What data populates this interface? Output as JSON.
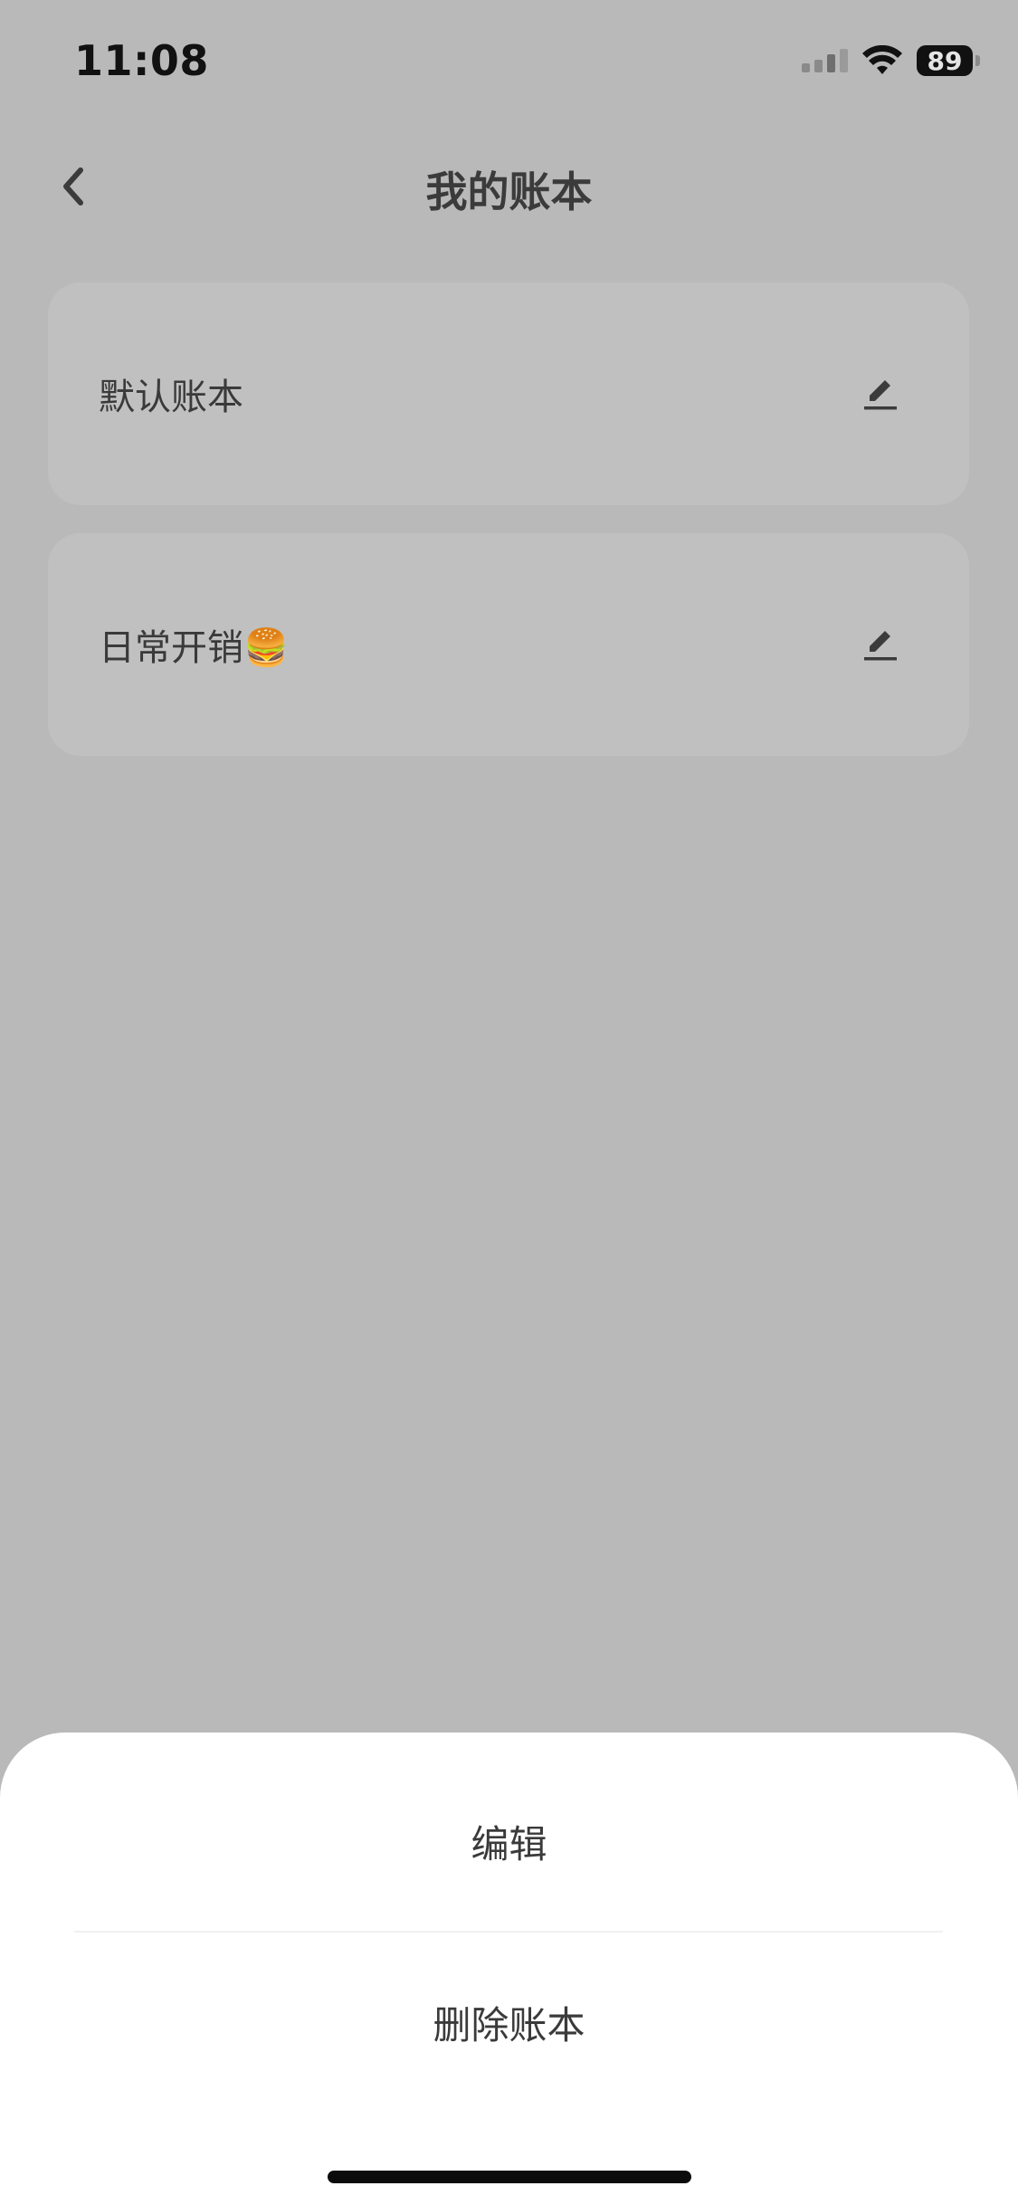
{
  "status": {
    "time": "11:08",
    "battery": "89"
  },
  "nav": {
    "title": "我的账本"
  },
  "books": [
    {
      "name": "默认账本"
    },
    {
      "name": "日常开销🍔"
    }
  ],
  "sheet": {
    "edit": "编辑",
    "delete": "删除账本"
  },
  "icons": {
    "back": "chevron-left-icon",
    "edit": "pencil-icon",
    "wifi": "wifi-icon"
  },
  "colors": {
    "overlay_bg": "#b9b9b9",
    "card_bg": "#c0c0c0",
    "sheet_bg": "#ffffff"
  }
}
